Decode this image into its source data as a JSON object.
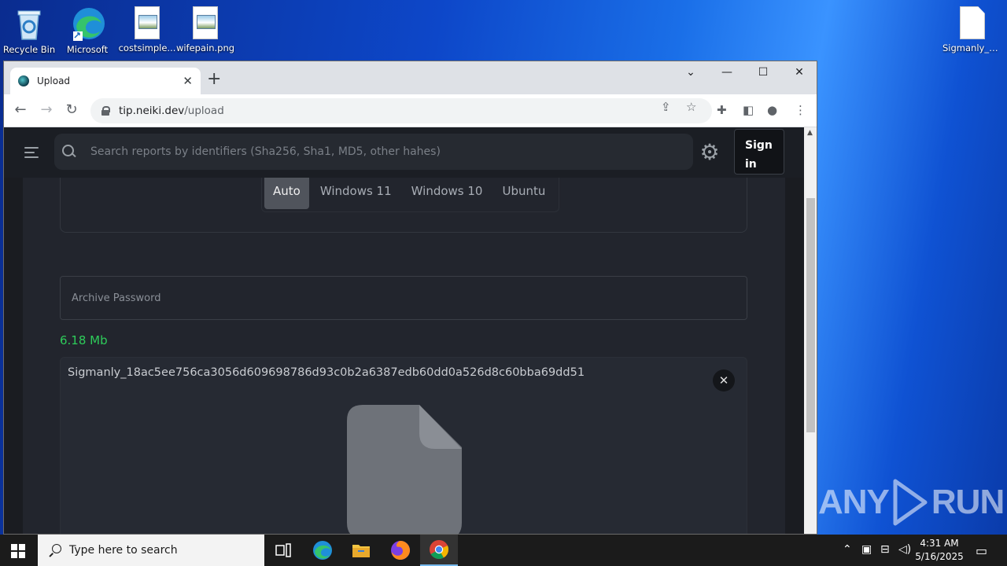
{
  "desktop": {
    "icons": [
      {
        "label": "Recycle Bin"
      },
      {
        "label": "Microsoft"
      },
      {
        "label": "costsimple..."
      },
      {
        "label": "wifepain.png"
      },
      {
        "label": "Sigmanly_1..."
      }
    ]
  },
  "browser": {
    "tab_title": "Upload",
    "url_host": "tip.neiki.dev",
    "url_path": "/upload"
  },
  "page": {
    "search_placeholder": "Search reports by identifiers (Sha256, Sha1, MD5, other hahes)",
    "signin_label": "Sign in",
    "os_options": [
      "Auto",
      "Windows 11",
      "Windows 10",
      "Ubuntu"
    ],
    "os_selected": "Auto",
    "archive_password_placeholder": "Archive Password",
    "file_size": "6.18 Mb",
    "file_name": "Sigmanly_18ac5ee756ca3056d609698786d93c0b2a6387edb60dd0a526d8c60bba69dd51"
  },
  "watermark": {
    "left": "ANY",
    "right": "RUN"
  },
  "taskbar": {
    "search_placeholder": "Type here to search",
    "time": "4:31 AM",
    "date": "5/16/2025"
  },
  "colors": {
    "file_size": "#2ecc5a",
    "os_active": "#50545c",
    "page_bg": "#22252d"
  }
}
